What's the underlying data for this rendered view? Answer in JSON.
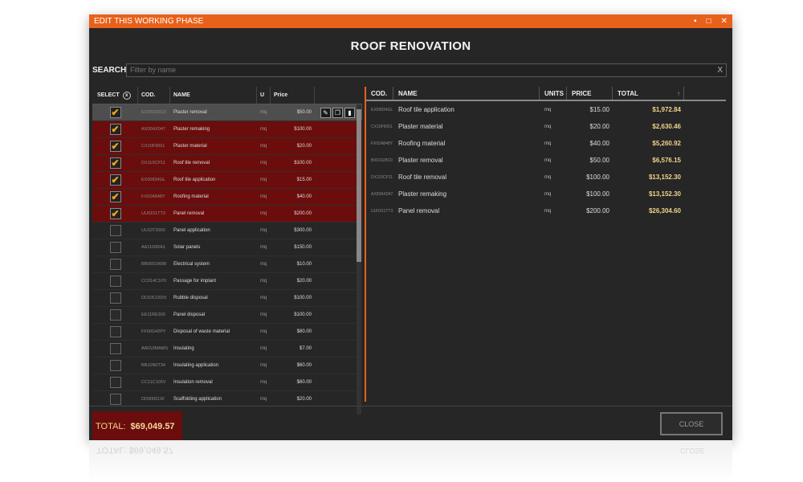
{
  "window": {
    "title": "EDIT THIS WORKING PHASE",
    "controls": {
      "minimize": "▪",
      "maximize": "□",
      "close": "✕"
    }
  },
  "heading": "ROOF RENOVATION",
  "search": {
    "label": "SEARCH",
    "placeholder": "Filter by name",
    "clear": "X"
  },
  "left": {
    "headers": {
      "select": "SELECT",
      "clear_icon": "x",
      "cod": "COD.",
      "name": "NAME",
      "u": "U",
      "price": "Price"
    },
    "rows": [
      {
        "code": "EXD5026C0",
        "name": "Plaster removal",
        "u": "mq",
        "price": "$50.00",
        "state": "hl",
        "checked": true
      },
      {
        "code": "AX00AX047",
        "name": "Plaster remaking",
        "u": "mq",
        "price": "$100.00",
        "state": "sel",
        "checked": true
      },
      {
        "code": "CX10F9001",
        "name": "Plaster material",
        "u": "mq",
        "price": "$20.00",
        "state": "sel",
        "checked": true
      },
      {
        "code": "DX110CP11",
        "name": "Roof tile removal",
        "u": "mq",
        "price": "$100.00",
        "state": "sel",
        "checked": true
      },
      {
        "code": "EX00834GL",
        "name": "Roof tile application",
        "u": "mq",
        "price": "$15.00",
        "state": "sel",
        "checked": true
      },
      {
        "code": "FX02A848Y",
        "name": "Roofing material",
        "u": "mq",
        "price": "$40.00",
        "state": "sel",
        "checked": true
      },
      {
        "code": "UU0151TT3",
        "name": "Panel removal",
        "u": "mq",
        "price": "$200.00",
        "state": "sel",
        "checked": true
      },
      {
        "code": "UU10T3000",
        "name": "Panel application",
        "u": "mq",
        "price": "$300.00",
        "state": "",
        "checked": false
      },
      {
        "code": "AA1100RA1",
        "name": "Solar panels",
        "u": "mq",
        "price": "$150.00",
        "state": "",
        "checked": false
      },
      {
        "code": "BB0001W98",
        "name": "Electrical system",
        "u": "mq",
        "price": "$10.00",
        "state": "",
        "checked": false
      },
      {
        "code": "CC014C1P0",
        "name": "Passage for implant",
        "u": "mq",
        "price": "$20.00",
        "state": "",
        "checked": false
      },
      {
        "code": "DD10CODIX",
        "name": "Rubble disposal",
        "u": "mq",
        "price": "$100.00",
        "state": "",
        "checked": false
      },
      {
        "code": "EE11RE300",
        "name": "Panel disposal",
        "u": "mq",
        "price": "$100.00",
        "state": "",
        "checked": false
      },
      {
        "code": "FF00G42PY",
        "name": "Disposal of waste material",
        "u": "mq",
        "price": "$80.00",
        "state": "",
        "checked": false
      },
      {
        "code": "AA010MAMS",
        "name": "Insulating",
        "u": "mq",
        "price": "$7.00",
        "state": "",
        "checked": false
      },
      {
        "code": "BB10N0T34",
        "name": "Insulating application",
        "u": "mq",
        "price": "$60.00",
        "state": "",
        "checked": false
      },
      {
        "code": "CC11C105V",
        "name": "Insulation removal",
        "u": "mq",
        "price": "$60.00",
        "state": "",
        "checked": false
      },
      {
        "code": "DD000011F",
        "name": "Scaffolding application",
        "u": "mq",
        "price": "$20.00",
        "state": "",
        "checked": false
      }
    ],
    "actions": {
      "edit": "✎",
      "copy": "❐",
      "delete": "▮"
    }
  },
  "right": {
    "headers": {
      "cod": "COD.",
      "name": "NAME",
      "units": "UNITS",
      "price": "PRICE",
      "total": "TOTAL",
      "sort_icon": "↑"
    },
    "rows": [
      {
        "code": "EX00834GL",
        "name": "Roof tile application",
        "units": "mq",
        "price": "$15.00",
        "total": "$1,972.84"
      },
      {
        "code": "CX10F9001",
        "name": "Plaster material",
        "units": "mq",
        "price": "$20.00",
        "total": "$2,630.46"
      },
      {
        "code": "FX02A848Y",
        "name": "Roofing material",
        "units": "mq",
        "price": "$40.00",
        "total": "$5,260.92"
      },
      {
        "code": "BX01628C0",
        "name": "Plaster removal",
        "units": "mq",
        "price": "$50.00",
        "total": "$6,576.15"
      },
      {
        "code": "DX110CP11",
        "name": "Roof tile removal",
        "units": "mq",
        "price": "$100.00",
        "total": "$13,152.30"
      },
      {
        "code": "AX00AX047",
        "name": "Plaster remaking",
        "units": "mq",
        "price": "$100.00",
        "total": "$13,152.30"
      },
      {
        "code": "UU0151TT3",
        "name": "Panel removal",
        "units": "mq",
        "price": "$200.00",
        "total": "$26,304.60"
      }
    ]
  },
  "footer": {
    "total_label": "TOTAL:",
    "total_value": "$69,049.57",
    "close_label": "CLOSE"
  },
  "colors": {
    "accent": "#e8611a",
    "selected_row": "#6b0d0d",
    "check": "#f2a71b",
    "total_text": "#f0d48a"
  }
}
